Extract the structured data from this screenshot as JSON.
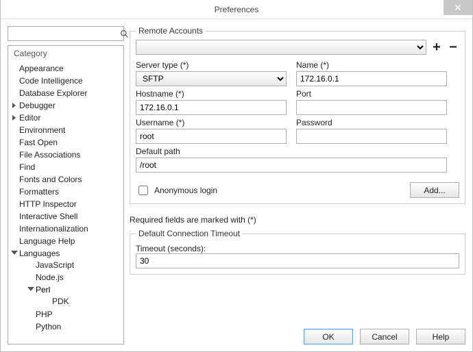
{
  "window": {
    "title": "Preferences",
    "close_glyph": "✕"
  },
  "filter": {
    "placeholder": ""
  },
  "category": {
    "heading": "Category",
    "items": {
      "appearance": "Appearance",
      "code_intel": "Code Intelligence",
      "db_explorer": "Database Explorer",
      "debugger": "Debugger",
      "editor": "Editor",
      "environment": "Environment",
      "fast_open": "Fast Open",
      "file_assoc": "File Associations",
      "find": "Find",
      "fonts_colors": "Fonts and Colors",
      "formatters": "Formatters",
      "http_inspector": "HTTP Inspector",
      "interactive_shell": "Interactive Shell",
      "i18n": "Internationalization",
      "lang_help": "Language Help",
      "languages": "Languages",
      "javascript": "JavaScript",
      "nodejs": "Node.js",
      "perl": "Perl",
      "pdk": "PDK",
      "php": "PHP",
      "python": "Python"
    }
  },
  "remote": {
    "legend": "Remote Accounts",
    "labels": {
      "server_type": "Server type (*)",
      "name": "Name (*)",
      "hostname": "Hostname (*)",
      "port": "Port",
      "username": "Username (*)",
      "password": "Password",
      "default_path": "Default path",
      "anonymous": "Anonymous login",
      "add": "Add...",
      "required_note": "Required fields are marked with (*)"
    },
    "values": {
      "server_type": "SFTP",
      "name": "172.16.0.1",
      "hostname": "172.16.0.1",
      "port": "",
      "username": "root",
      "password": "",
      "default_path": "/root"
    }
  },
  "timeout": {
    "legend": "Default Connection Timeout",
    "label": "Timeout (seconds):",
    "value": "30"
  },
  "buttons": {
    "ok": "OK",
    "cancel": "Cancel",
    "help": "Help"
  }
}
